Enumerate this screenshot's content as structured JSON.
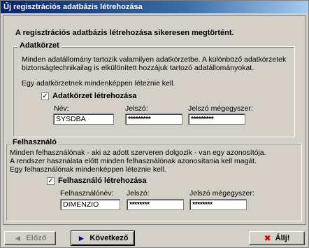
{
  "window": {
    "title": "Új regisztrációs adatbázis létrehozása"
  },
  "success_message": "A regisztrációs adatbázis létrehozása sikeresen megtörtént.",
  "adatkorzet": {
    "legend": "Adatkörzet",
    "description_line1": "Minden adatállomány tartozik valamilyen adatkörzetbe. A különböző adatkörzetek",
    "description_line2": "biztonságtechnikailag is elkülönített hozzájuk tartozó adatállományokat.",
    "description_line3": "Egy adatkörzetnek mindenképpen léteznie kell.",
    "checkbox_label": "Adatkörzet létrehozása",
    "checked": true,
    "name_label": "Név:",
    "name_value": "SYSDBA",
    "password_label": "Jelszó:",
    "password_value": "*********",
    "password_confirm_label": "Jelszó mégegyszer:",
    "password_confirm_value": "*********"
  },
  "felhasznalo": {
    "legend": "Felhasználó",
    "description_line1": "Minden felhasználónak - aki az adott szerveren dolgozik - van egy azonosítója.",
    "description_line2": "A rendszer használata előtt minden felhasználónak azonosítania kell magát.",
    "description_line3": "Egy felhasználónak mindenképpen léteznie kell.",
    "checkbox_label": "Felhasználó létrehozása",
    "checked": true,
    "username_label": "Felhasználónév:",
    "username_value": "DIMENZIO",
    "password_label": "Jelszó:",
    "password_value": "********",
    "password_confirm_label": "Jelszó mégegyszer:",
    "password_confirm_value": "********"
  },
  "buttons": {
    "prev_label": "Előző",
    "next_label": "Következő",
    "stop_label": "Állj!"
  },
  "icons": {
    "checkmark": "✓",
    "prev_icon": "◄",
    "next_icon": "►",
    "stop_icon": "✖"
  },
  "colors": {
    "titlebar_start": "#0a246a",
    "stop_icon": "#cc0000",
    "next_icon": "#0000a0"
  }
}
